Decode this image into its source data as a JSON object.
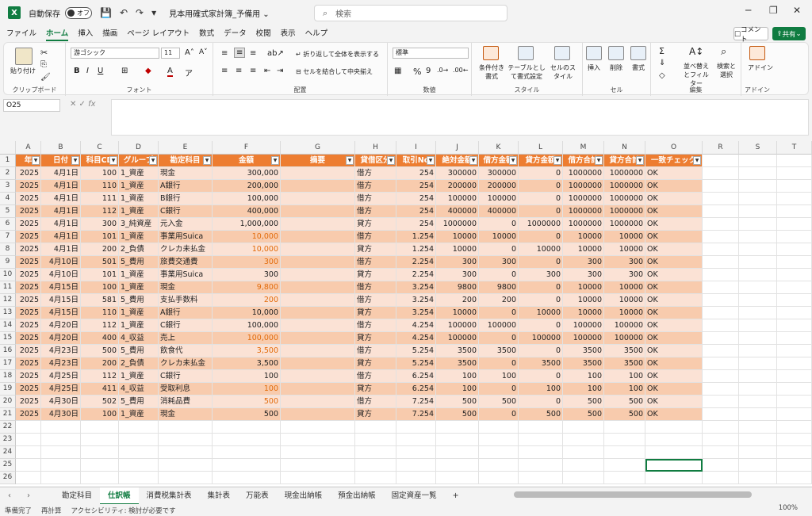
{
  "title_bar": {
    "autosave_label": "自動保存",
    "autosave_state": "オフ",
    "file_name": "見本用確式家計簿_予備用 ⌄",
    "search_placeholder": "検索"
  },
  "menu_tabs": [
    "ファイル",
    "ホーム",
    "挿入",
    "描画",
    "ページ レイアウト",
    "数式",
    "データ",
    "校閲",
    "表示",
    "ヘルプ"
  ],
  "active_menu": "ホーム",
  "comment_label": "コメント",
  "share_label": "共有",
  "ribbon": {
    "groups": [
      "クリップボード",
      "フォント",
      "配置",
      "数値",
      "スタイル",
      "セル",
      "編集",
      "アドイン"
    ],
    "paste": "貼り付け",
    "font_name": "游ゴシック",
    "font_size": "11",
    "wrap_text": "折り返して全体を表示する",
    "merge_center": "セルを結合して中央揃え",
    "number_format": "標準",
    "cond_format": "条件付き書式",
    "table_format": "テーブルとして書式設定",
    "cell_style": "セルのスタイル",
    "insert": "挿入",
    "delete": "削除",
    "format": "書式",
    "sort_filter": "並べ替えとフィルター",
    "find_select": "検索と選択",
    "addin": "アドイン"
  },
  "name_box": "O25",
  "columns": [
    "A",
    "B",
    "C",
    "D",
    "E",
    "F",
    "G",
    "H",
    "I",
    "J",
    "K",
    "L",
    "M",
    "N",
    "O",
    "R",
    "S",
    "T"
  ],
  "table_headers": [
    "年",
    "日付",
    "科目CD",
    "グループ",
    "勘定科目",
    "金額",
    "摘要",
    "貸借区分",
    "取引No",
    "絶対金額",
    "借方金額",
    "貸方金額",
    "借方合計",
    "貸方合計",
    "一致チェック"
  ],
  "rows": [
    [
      "2025",
      "4月1日",
      "100",
      "1_資産",
      "現金",
      "300,000",
      "",
      "借方",
      "254",
      "300000",
      "300000",
      "0",
      "1000000",
      "1000000",
      "OK"
    ],
    [
      "2025",
      "4月1日",
      "110",
      "1_資産",
      "A銀行",
      "200,000",
      "",
      "借方",
      "254",
      "200000",
      "200000",
      "0",
      "1000000",
      "1000000",
      "OK"
    ],
    [
      "2025",
      "4月1日",
      "111",
      "1_資産",
      "B銀行",
      "100,000",
      "",
      "借方",
      "254",
      "100000",
      "100000",
      "0",
      "1000000",
      "1000000",
      "OK"
    ],
    [
      "2025",
      "4月1日",
      "112",
      "1_資産",
      "C銀行",
      "400,000",
      "",
      "借方",
      "254",
      "400000",
      "400000",
      "0",
      "1000000",
      "1000000",
      "OK"
    ],
    [
      "2025",
      "4月1日",
      "300",
      "3_純資産",
      "元入金",
      "1,000,000",
      "",
      "貸方",
      "254",
      "1000000",
      "0",
      "1000000",
      "1000000",
      "1000000",
      "OK"
    ],
    [
      "2025",
      "4月1日",
      "101",
      "1_資産",
      "事業用Suica",
      "10,000",
      "",
      "借方",
      "1.254",
      "10000",
      "10000",
      "0",
      "10000",
      "10000",
      "OK"
    ],
    [
      "2025",
      "4月1日",
      "200",
      "2_負債",
      "クレカ未払金",
      "10,000",
      "",
      "貸方",
      "1.254",
      "10000",
      "0",
      "10000",
      "10000",
      "10000",
      "OK"
    ],
    [
      "2025",
      "4月10日",
      "501",
      "5_費用",
      "旅費交通費",
      "300",
      "",
      "借方",
      "2.254",
      "300",
      "300",
      "0",
      "300",
      "300",
      "OK"
    ],
    [
      "2025",
      "4月10日",
      "101",
      "1_資産",
      "事業用Suica",
      "300",
      "",
      "貸方",
      "2.254",
      "300",
      "0",
      "300",
      "300",
      "300",
      "OK"
    ],
    [
      "2025",
      "4月15日",
      "100",
      "1_資産",
      "現金",
      "9,800",
      "",
      "借方",
      "3.254",
      "9800",
      "9800",
      "0",
      "10000",
      "10000",
      "OK"
    ],
    [
      "2025",
      "4月15日",
      "581",
      "5_費用",
      "支払手数料",
      "200",
      "",
      "借方",
      "3.254",
      "200",
      "200",
      "0",
      "10000",
      "10000",
      "OK"
    ],
    [
      "2025",
      "4月15日",
      "110",
      "1_資産",
      "A銀行",
      "10,000",
      "",
      "貸方",
      "3.254",
      "10000",
      "0",
      "10000",
      "10000",
      "10000",
      "OK"
    ],
    [
      "2025",
      "4月20日",
      "112",
      "1_資産",
      "C銀行",
      "100,000",
      "",
      "借方",
      "4.254",
      "100000",
      "100000",
      "0",
      "100000",
      "100000",
      "OK"
    ],
    [
      "2025",
      "4月20日",
      "400",
      "4_収益",
      "売上",
      "100,000",
      "",
      "貸方",
      "4.254",
      "100000",
      "0",
      "100000",
      "100000",
      "100000",
      "OK"
    ],
    [
      "2025",
      "4月23日",
      "500",
      "5_費用",
      "飲食代",
      "3,500",
      "",
      "借方",
      "5.254",
      "3500",
      "3500",
      "0",
      "3500",
      "3500",
      "OK"
    ],
    [
      "2025",
      "4月23日",
      "200",
      "2_負債",
      "クレカ未払金",
      "3,500",
      "",
      "貸方",
      "5.254",
      "3500",
      "0",
      "3500",
      "3500",
      "3500",
      "OK"
    ],
    [
      "2025",
      "4月25日",
      "112",
      "1_資産",
      "C銀行",
      "100",
      "",
      "借方",
      "6.254",
      "100",
      "100",
      "0",
      "100",
      "100",
      "OK"
    ],
    [
      "2025",
      "4月25日",
      "411",
      "4_収益",
      "受取利息",
      "100",
      "",
      "貸方",
      "6.254",
      "100",
      "0",
      "100",
      "100",
      "100",
      "OK"
    ],
    [
      "2025",
      "4月30日",
      "502",
      "5_費用",
      "消耗品費",
      "500",
      "",
      "借方",
      "7.254",
      "500",
      "500",
      "0",
      "500",
      "500",
      "OK"
    ],
    [
      "2025",
      "4月30日",
      "100",
      "1_資産",
      "現金",
      "500",
      "",
      "貸方",
      "7.254",
      "500",
      "0",
      "500",
      "500",
      "500",
      "OK"
    ]
  ],
  "orange_amount_rows": [
    7,
    8,
    9,
    11,
    12,
    15,
    16,
    19,
    20
  ],
  "sheet_tabs": [
    "勘定科目",
    "仕訳帳",
    "消費税集計表",
    "集計表",
    "万能表",
    "現金出納帳",
    "預金出納帳",
    "固定資産一覧"
  ],
  "active_sheet": "仕訳帳",
  "status": {
    "ready": "準備完了",
    "recalc": "再計算",
    "accessibility": "アクセシビリティ: 検討が必要です",
    "zoom": "100%"
  },
  "colors": {
    "header_orange": "#ed7d31",
    "band_light": "#fbe2d5",
    "band_dark": "#f8cbad",
    "excel_green": "#107c41"
  }
}
